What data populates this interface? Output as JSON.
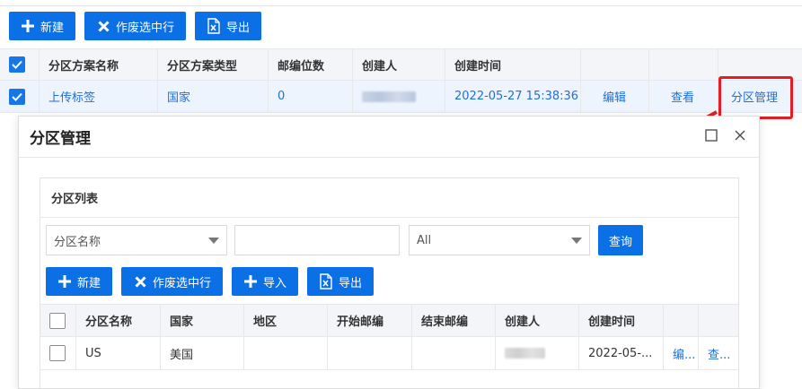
{
  "toolbar": {
    "new_label": "新建",
    "void_label": "作废选中行",
    "export_label": "导出"
  },
  "main_table": {
    "headers": [
      "分区方案名称",
      "分区方案类型",
      "邮编位数",
      "创建人",
      "创建时间"
    ],
    "row": {
      "name": "上传标签",
      "type": "国家",
      "digits": "0",
      "created_at": "2022-05-27 15:38:36",
      "action_edit": "编辑",
      "action_view": "查看",
      "action_manage": "分区管理"
    }
  },
  "modal": {
    "title": "分区管理",
    "panel_title": "分区列表",
    "filter_field": "分区名称",
    "filter_value": "",
    "filter_status": "All",
    "query_label": "查询",
    "toolbar": {
      "new_label": "新建",
      "void_label": "作废选中行",
      "import_label": "导入",
      "export_label": "导出"
    },
    "table": {
      "headers": [
        "分区名称",
        "国家",
        "地区",
        "开始邮编",
        "结束邮编",
        "创建人",
        "创建时间"
      ],
      "row": {
        "name": "US",
        "country": "美国",
        "region": "",
        "start_zip": "",
        "end_zip": "",
        "created_at": "2022-05-...",
        "action_edit": "编...",
        "action_view": "查..."
      }
    }
  },
  "colors": {
    "primary": "#0b6fe6",
    "link": "#1f6fd6",
    "highlight": "#e31e24"
  }
}
